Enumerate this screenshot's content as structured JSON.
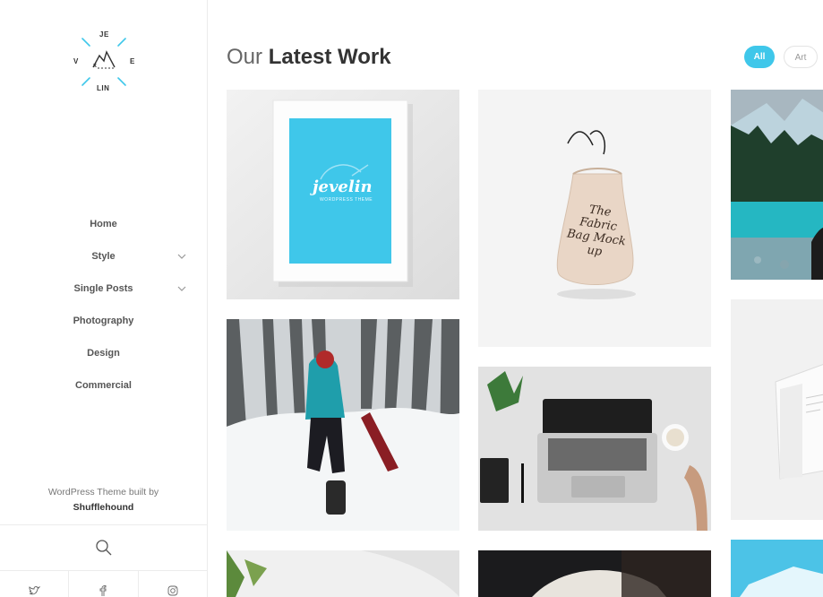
{
  "logo": {
    "top": "JE",
    "left": "V",
    "right": "E",
    "bottom": "LIN",
    "accent": "#3fc7ea"
  },
  "nav": {
    "items": [
      {
        "label": "Home",
        "has_submenu": false
      },
      {
        "label": "Style",
        "has_submenu": true
      },
      {
        "label": "Single Posts",
        "has_submenu": true
      },
      {
        "label": "Photography",
        "has_submenu": false
      },
      {
        "label": "Design",
        "has_submenu": false
      },
      {
        "label": "Commercial",
        "has_submenu": false
      }
    ]
  },
  "credit": {
    "line": "WordPress Theme built by",
    "author": "Shufflehound"
  },
  "social": [
    "twitter-icon",
    "facebook-icon",
    "instagram-icon"
  ],
  "header": {
    "title_light": "Our",
    "title_bold": "Latest Work"
  },
  "filters": [
    {
      "label": "All",
      "active": true
    },
    {
      "label": "Art",
      "active": false
    }
  ],
  "portfolio": {
    "frame_mockup": {
      "brand": "jevelin",
      "tagline": "WORDPRESS THEME"
    },
    "bag_mockup": {
      "text": "The Fabric Bag Mock up"
    }
  }
}
